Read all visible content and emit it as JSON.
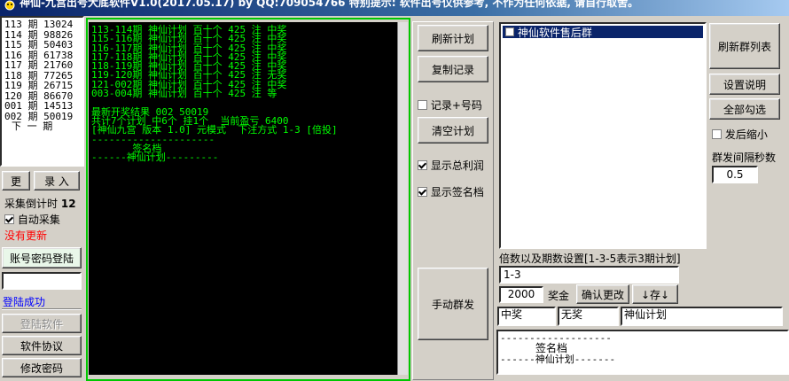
{
  "window": {
    "title": "神仙-九宫出号大底软件V1.0(2017.05.17)  by QQ:709054766 特别提示: 软件出号仅供参考, 不作为任何依据, 请自行取舍。"
  },
  "issue_list": {
    "rows": [
      "113 期 13024",
      "114 期 98826",
      "115 期 50403",
      "116 期 61738",
      "117 期 21760",
      "118 期 77265",
      "119 期 26715",
      "120 期 86670",
      "001 期 14513",
      "002 期 50019"
    ],
    "next": "下 一 期"
  },
  "left": {
    "update_label": "更",
    "enter_label": "录 入",
    "countdown_label": "采集倒计时",
    "countdown_value": "12",
    "auto_collect_label": "自动采集",
    "no_update": "没有更新",
    "login_button": "账号密码登陆",
    "login_status": "登陆成功",
    "login_software": "登陆软件",
    "software_agreement": "软件协议",
    "change_password": "修改密码"
  },
  "console": {
    "lines": [
      "113-114期 神仙计划 百十个 425 注 中奖",
      "115-116期 神仙计划 百十个 425 注 中奖",
      "116-117期 神仙计划 百十个 425 注 中奖",
      "117-118期 神仙计划 百十个 425 注 中奖",
      "118-119期 神仙计划 百十个 425 注 中奖",
      "119-120期 神仙计划 百十个 425 注 无奖",
      "121-002期 神仙计划 百十个 425 注 中奖",
      "003-004期 神仙计划 百十个 425 注 等",
      "",
      "最新开奖结果 002 50019",
      "共计7个计划 中6个 挂1个  当前盈亏 6400",
      "[神仙九宫 版本 1.0] 元模式  下注方式 1-3 [倍投]",
      "---------------------",
      "       签名档",
      "------神仙计划---------"
    ]
  },
  "middle": {
    "refresh_plan": "刷新计划",
    "copy_record": "复制记录",
    "record_plus_number": "记录+号码",
    "clear_plan": "清空计划",
    "show_profit": "显示总利润",
    "show_signature": "显示签名档",
    "manual_send": "手动群发"
  },
  "groups": {
    "items": [
      "神仙软件售后群"
    ],
    "refresh_groups": "刷新群列表",
    "settings_help": "设置说明",
    "select_all": "全部勾选",
    "minimize_after_send": "发后缩小",
    "interval_label": "群发间隔秒数",
    "interval_value": "0.5"
  },
  "multiplier": {
    "label": "倍数以及期数设置[1-3-5表示3期计划]",
    "value": "1-3",
    "prize_value": "2000",
    "prize_label": "奖金",
    "confirm_change": "确认更改",
    "save_label": "↓存↓"
  },
  "results": {
    "win": "中奖",
    "nowin": "无奖",
    "plan_name": "神仙计划"
  },
  "signature": {
    "lines": [
      "-------------------",
      "签名档",
      "------神仙计划-------"
    ]
  },
  "colors": {
    "console_bg": "#000000",
    "console_text": "#00ff00",
    "error_red": "#ff0000",
    "success_blue": "#0000ff"
  }
}
